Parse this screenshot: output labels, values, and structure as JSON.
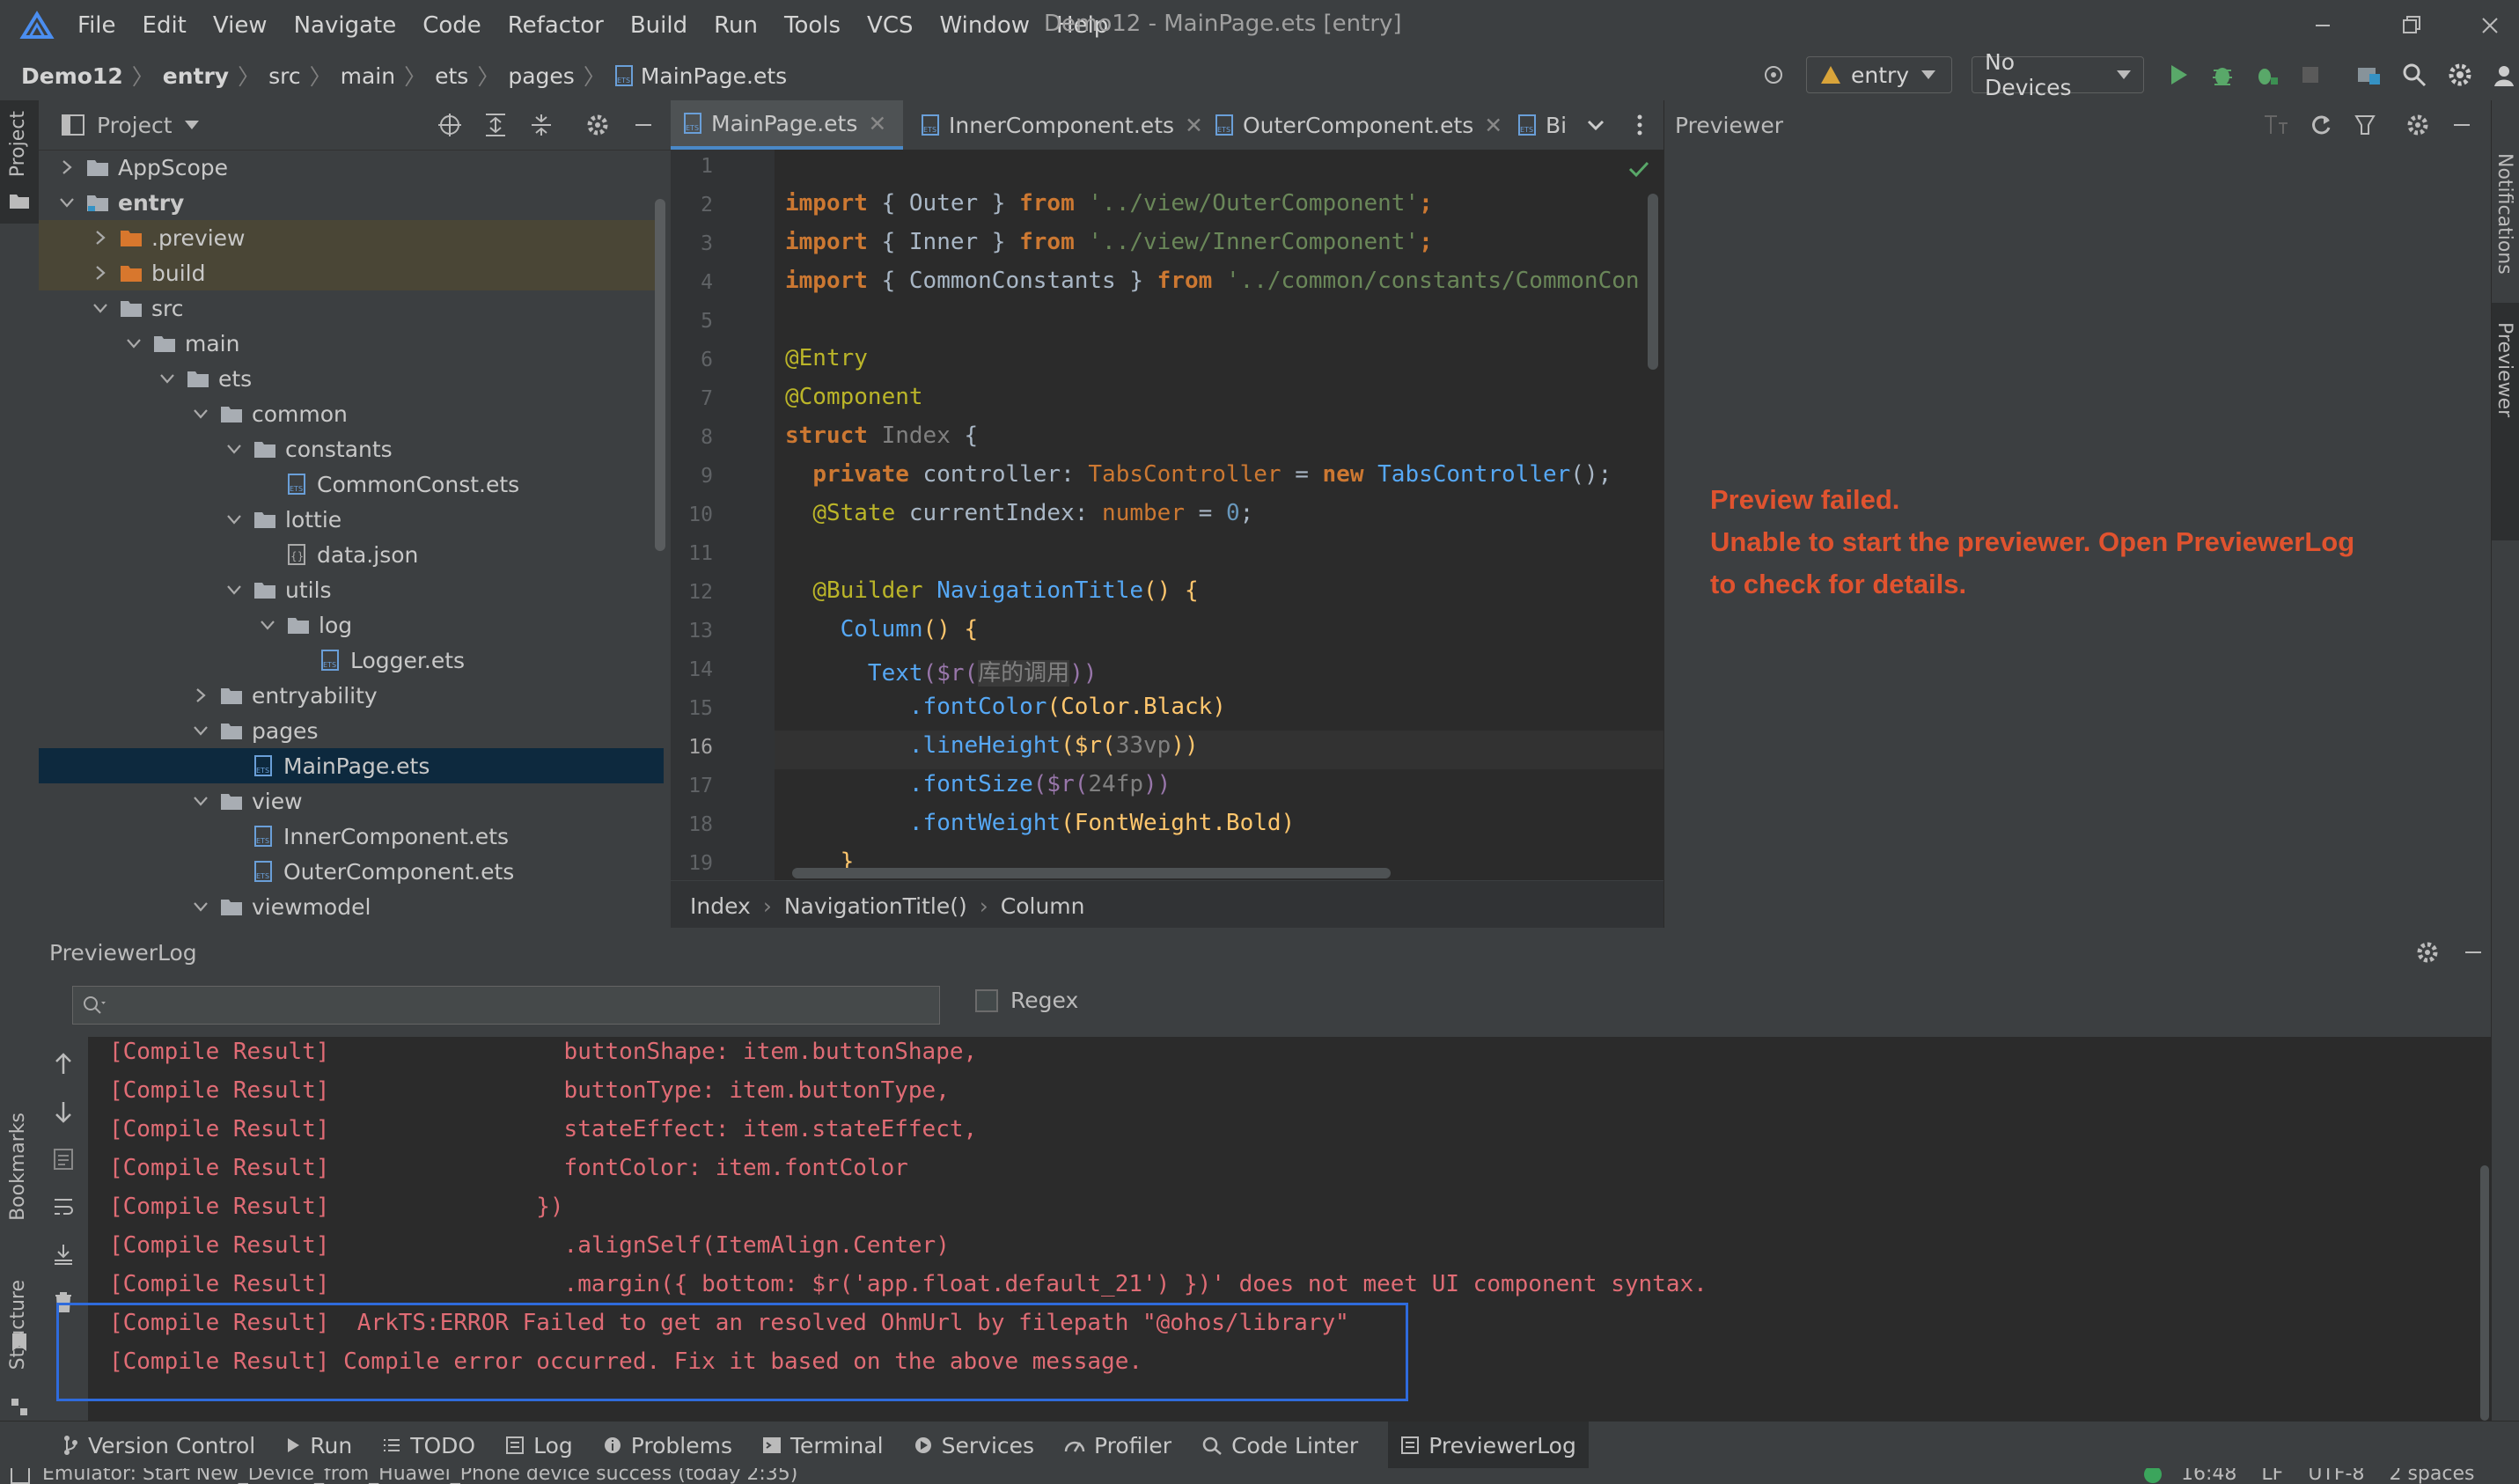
{
  "window": {
    "title": "Demo12 - MainPage.ets [entry]",
    "menu": [
      "File",
      "Edit",
      "View",
      "Navigate",
      "Code",
      "Refactor",
      "Build",
      "Run",
      "Tools",
      "VCS",
      "Window",
      "Help"
    ]
  },
  "breadcrumb": [
    "Demo12",
    "entry",
    "src",
    "main",
    "ets",
    "pages",
    "MainPage.ets"
  ],
  "toolbar": {
    "module": "entry",
    "device": "No Devices"
  },
  "project": {
    "title": "Project",
    "tree": [
      {
        "label": "AppScope",
        "kind": "folder",
        "level": 0,
        "expanded": false
      },
      {
        "label": "entry",
        "kind": "module",
        "level": 0,
        "expanded": true
      },
      {
        "label": ".preview",
        "kind": "orange",
        "level": 1,
        "expanded": false
      },
      {
        "label": "build",
        "kind": "orange",
        "level": 1,
        "expanded": false
      },
      {
        "label": "src",
        "kind": "folder",
        "level": 1,
        "expanded": true
      },
      {
        "label": "main",
        "kind": "folder",
        "level": 2,
        "expanded": true
      },
      {
        "label": "ets",
        "kind": "folder",
        "level": 3,
        "expanded": true
      },
      {
        "label": "common",
        "kind": "folder",
        "level": 4,
        "expanded": true
      },
      {
        "label": "constants",
        "kind": "folder",
        "level": 5,
        "expanded": true
      },
      {
        "label": "CommonConst.ets",
        "kind": "ets",
        "level": 6
      },
      {
        "label": "lottie",
        "kind": "folder",
        "level": 5,
        "expanded": true
      },
      {
        "label": "data.json",
        "kind": "json",
        "level": 6
      },
      {
        "label": "utils",
        "kind": "folder",
        "level": 5,
        "expanded": true
      },
      {
        "label": "log",
        "kind": "folder",
        "level": 6,
        "expanded": true
      },
      {
        "label": "Logger.ets",
        "kind": "ets",
        "level": 7
      },
      {
        "label": "entryability",
        "kind": "folder",
        "level": 4,
        "expanded": false
      },
      {
        "label": "pages",
        "kind": "folder",
        "level": 4,
        "expanded": true
      },
      {
        "label": "MainPage.ets",
        "kind": "ets",
        "level": 5
      },
      {
        "label": "view",
        "kind": "folder",
        "level": 4,
        "expanded": true
      },
      {
        "label": "InnerComponent.ets",
        "kind": "ets",
        "level": 5
      },
      {
        "label": "OuterComponent.ets",
        "kind": "ets",
        "level": 5
      },
      {
        "label": "viewmodel",
        "kind": "folder",
        "level": 4,
        "expanded": true
      }
    ]
  },
  "editor": {
    "tabs": [
      "MainPage.ets",
      "InnerComponent.ets",
      "OuterComponent.ets",
      "Bi"
    ],
    "line_numbers": [
      "1",
      "2",
      "3",
      "4",
      "5",
      "6",
      "7",
      "8",
      "9",
      "10",
      "11",
      "12",
      "13",
      "14",
      "15",
      "16",
      "17",
      "18",
      "19"
    ],
    "code": {
      "l2a": "import",
      "l2b": "{ Outer }",
      "l2c": "from",
      "l2d": "'../view/OuterComponent'",
      "l2e": ";",
      "l3a": "import",
      "l3b": "{ Inner }",
      "l3c": "from",
      "l3d": "'../view/InnerComponent'",
      "l3e": ";",
      "l4a": "import",
      "l4b": "{ CommonConstants }",
      "l4c": "from",
      "l4d": "'../common/constants/CommonCon",
      "l6": "@Entry",
      "l7": "@Component",
      "l8a": "struct",
      "l8b": "Index",
      "l8c": "{",
      "l9a": "private",
      "l9b": "controller:",
      "l9c": "TabsController",
      "l9d": "=",
      "l9e": "new",
      "l9f": "TabsController",
      "l9g": "();",
      "l10a": "@State",
      "l10b": "currentIndex:",
      "l10c": "number",
      "l10d": "=",
      "l10e": "0",
      "l10f": ";",
      "l12a": "@Builder",
      "l12b": "NavigationTitle",
      "l12c": "() {",
      "l13a": "Column",
      "l13b": "() {",
      "l14a": "Text",
      "l14b": "($r(",
      "l14c": "库的调用",
      "l14d": "))",
      "l15a": ".fontColor",
      "l15b": "(Color.Black)",
      "l16a": ".lineHeight",
      "l16b": "($r(",
      "l16c": "33vp",
      "l16d": "))",
      "l17a": ".fontSize",
      "l17b": "($r(",
      "l17c": "24fp",
      "l17d": "))",
      "l18a": ".fontWeight",
      "l18b": "(FontWeight.Bold)",
      "l19": "}"
    },
    "breadcrumb": [
      "Index",
      "NavigationTitle()",
      "Column"
    ]
  },
  "previewer": {
    "title": "Previewer",
    "error_lines": [
      "Preview failed.",
      "Unable to start the previewer. Open PreviewerLog",
      "to check for details."
    ]
  },
  "log": {
    "title": "PreviewerLog",
    "search_placeholder": "",
    "regex_label": "Regex",
    "lines": [
      "[Compile Result]                 buttonShape: item.buttonShape,",
      "[Compile Result]                 buttonType: item.buttonType,",
      "[Compile Result]                 stateEffect: item.stateEffect,",
      "[Compile Result]                 fontColor: item.fontColor",
      "[Compile Result]               })",
      "[Compile Result]                 .alignSelf(ItemAlign.Center)",
      "[Compile Result]                 .margin({ bottom: $r('app.float.default_21') })' does not meet UI component syntax.",
      "[Compile Result]  ArkTS:ERROR Failed to get an resolved OhmUrl by filepath \"@ohos/library\"",
      "[Compile Result] Compile error occurred. Fix it based on the above message."
    ]
  },
  "left_stripe": {
    "project": "Project",
    "bookmarks": "Bookmarks",
    "structure": "Structure"
  },
  "right_stripe": {
    "notifications": "Notifications",
    "previewer": "Previewer"
  },
  "tool_windows": [
    "Version Control",
    "Run",
    "TODO",
    "Log",
    "Problems",
    "Terminal",
    "Services",
    "Profiler",
    "Code Linter",
    "PreviewerLog"
  ],
  "status": {
    "message": "Emulator: Start New_Device_from_Huawei_Phone device success (today 2:35)",
    "time": "16:48",
    "line_sep": "LF",
    "encoding": "UTF-8",
    "indent": "2 spaces"
  },
  "colors": {
    "error": "#e0532f",
    "log_text": "#e06c75",
    "highlight_box": "#2f6bdc"
  }
}
